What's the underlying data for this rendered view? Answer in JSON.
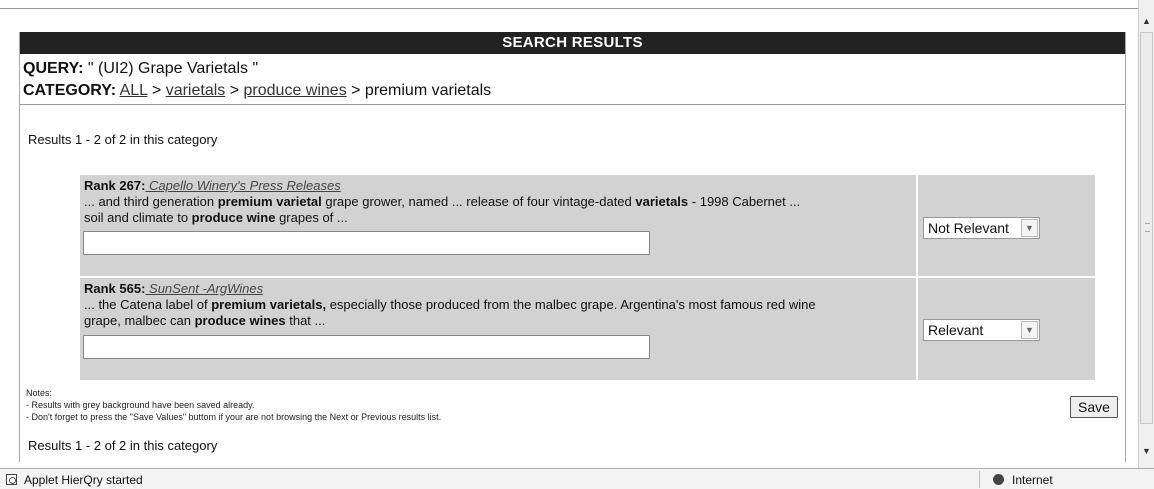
{
  "header": {
    "title": "SEARCH RESULTS"
  },
  "query": {
    "label": "QUERY:",
    "value": " \" (UI2) Grape Varietals \""
  },
  "category": {
    "label": "CATEGORY:",
    "crumbs": [
      "ALL",
      "varietals",
      "produce wines",
      "premium varietals"
    ],
    "separator": " > "
  },
  "results_summary": "Results 1 - 2 of 2 in this category",
  "results": [
    {
      "rank_label": "Rank 267:",
      "link_text": " Capello Winery's Press Releases",
      "snippet_line1": [
        "... and third generation ",
        "premium varietal",
        " grape grower, named ... release of four vintage-dated ",
        "varietals",
        " - 1998 Cabernet ..."
      ],
      "snippet_line2": [
        "soil and climate to ",
        "produce wine",
        " grapes of ..."
      ],
      "note_value": "",
      "relevance": "Not Relevant"
    },
    {
      "rank_label": "Rank 565:",
      "link_text": " SunSent -ArgWines",
      "snippet_line1": [
        "... the Catena label of ",
        "premium varietals,",
        " especially those produced from the malbec grape. Argentina's most famous red wine"
      ],
      "snippet_line2": [
        "grape, malbec can ",
        "produce wines",
        " that ..."
      ],
      "note_value": "",
      "relevance": "Relevant"
    }
  ],
  "notes": {
    "title": "Notes:",
    "lines": [
      "- Results with grey background have been saved already.",
      "- Don't forget to press the \"Save Values\" buttom if your are not browsing the Next or Previous results list."
    ]
  },
  "save_button": "Save",
  "status": {
    "text": "Applet HierQry started",
    "zone": "Internet"
  },
  "icons": {
    "select_arrow": "chevron-down-icon",
    "scroll_up": "up-arrow-icon",
    "scroll_down": "down-arrow-icon",
    "zone": "globe-icon",
    "page": "page-icon"
  }
}
